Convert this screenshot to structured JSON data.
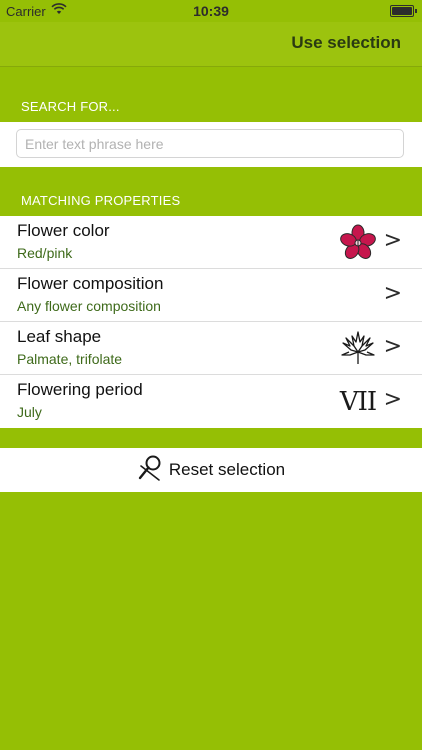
{
  "status_bar": {
    "carrier": "Carrier",
    "time": "10:39"
  },
  "nav": {
    "use_selection": "Use selection"
  },
  "search": {
    "header": "SEARCH FOR...",
    "placeholder": "Enter text phrase here",
    "value": ""
  },
  "properties": {
    "header": "MATCHING PROPERTIES",
    "items": [
      {
        "title": "Flower color",
        "value": "Red/pink",
        "icon": "flower-icon"
      },
      {
        "title": "Flower composition",
        "value": "Any flower composition",
        "icon": ""
      },
      {
        "title": "Leaf shape",
        "value": "Palmate, trifolate",
        "icon": "palmate-leaf-icon"
      },
      {
        "title": "Flowering period",
        "value": "July",
        "icon": "month-roman-numeral",
        "icon_text": "VII"
      }
    ],
    "chevron": ">"
  },
  "reset": {
    "label": "Reset selection",
    "icon": "reset-magnifier-icon"
  },
  "colors": {
    "background": "#95bf05",
    "flower_red": "#c6164d",
    "value_text": "#3e6a1a"
  }
}
